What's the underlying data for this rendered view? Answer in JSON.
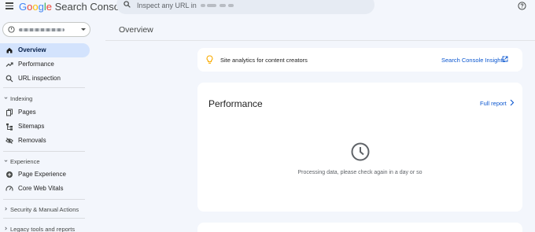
{
  "header": {
    "logo_google": [
      "G",
      "o",
      "o",
      "g",
      "l",
      "e"
    ],
    "product_name": "Search Console",
    "search_placeholder": "Inspect any URL in"
  },
  "sidebar": {
    "items": [
      {
        "label": "Overview",
        "icon": "home-icon",
        "active": true
      },
      {
        "label": "Performance",
        "icon": "trending-up-icon"
      },
      {
        "label": "URL inspection",
        "icon": "search-icon"
      }
    ],
    "sections": [
      {
        "label": "Indexing",
        "items": [
          {
            "label": "Pages",
            "icon": "pages-icon"
          },
          {
            "label": "Sitemaps",
            "icon": "sitemap-icon"
          },
          {
            "label": "Removals",
            "icon": "visibility-off-icon"
          }
        ]
      },
      {
        "label": "Experience",
        "items": [
          {
            "label": "Page Experience",
            "icon": "add-circle-icon"
          },
          {
            "label": "Core Web Vitals",
            "icon": "speed-icon"
          }
        ]
      },
      {
        "label": "Security & Manual Actions"
      },
      {
        "label": "Legacy tools and reports"
      }
    ]
  },
  "main": {
    "title": "Overview",
    "insights": {
      "text": "Site analytics for content creators",
      "link": "Search Console Insights"
    },
    "performance": {
      "title": "Performance",
      "full_report": "Full report",
      "message": "Processing data, please check again in a day or so"
    }
  },
  "colors": {
    "background": "#f3f6fc",
    "active_nav": "#d3e3fd",
    "link": "#0b57d0",
    "bulb": "#f9ab00"
  }
}
